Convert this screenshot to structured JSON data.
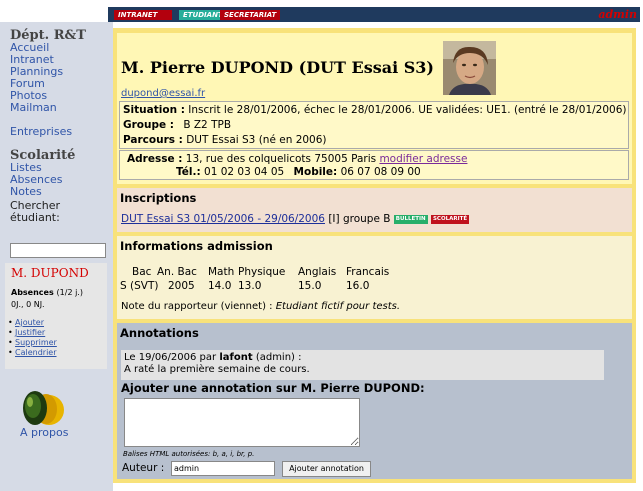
{
  "topbar": {
    "tabs": [
      "INTRANET R&T",
      "ETUDIANT",
      "SECRETARIAT"
    ],
    "admin": "admin"
  },
  "sidebar": {
    "dept_title": "Dépt. R&T",
    "links": [
      "Accueil",
      "Intranet",
      "Plannings",
      "Forum",
      "Photos",
      "Mailman"
    ],
    "entreprises": "Entreprises",
    "scol_title": "Scolarité",
    "scol_links": [
      "Listes",
      "Absences",
      "Notes"
    ],
    "cherche_label_1": "Chercher",
    "cherche_label_2": "étudiant:",
    "student_name": "M. DUPOND",
    "absences_title": "Absences",
    "absences_unit": "(1/2 j.)",
    "absences_count": "0J., 0 NJ.",
    "abs_actions": [
      "Ajouter",
      "Justifier",
      "Supprimer",
      "Calendrier"
    ],
    "apropos": "A propos"
  },
  "fiche": {
    "title": "M. Pierre DUPOND (DUT Essai S3)",
    "email": "dupond@essai.fr",
    "situation_label": "Situation :",
    "situation": "Inscrit le 28/01/2006, échec le 28/01/2006. UE validées: UE1. (entré le 28/01/2006)",
    "groupe_label": "Groupe :",
    "groupe": "B Z2 TPB",
    "parcours_label": "Parcours :",
    "parcours": "DUT Essai S3 (né en 2006)",
    "adresse_label": "Adresse :",
    "adresse": "13, rue des colquelicots 75005 Paris",
    "modifier": "modifier adresse",
    "tel_label": "Tél.:",
    "tel": "01 02 03 04 05",
    "mobile_label": "Mobile:",
    "mobile": "06 07 08 09 00"
  },
  "inscriptions": {
    "title": "Inscriptions",
    "link": "DUT Essai S3 01/05/2006 - 29/06/2006",
    "rest": "[I] groupe B",
    "bulletin": "BULLETIN",
    "scolarite": "SCOLARITÉ"
  },
  "admission": {
    "title": "Informations admission",
    "headers": [
      "Bac",
      "An. Bac",
      "Math",
      "Physique",
      "Anglais",
      "Francais"
    ],
    "values": [
      "S (SVT)",
      "2005",
      "14.0",
      "13.0",
      "15.0",
      "16.0"
    ],
    "note_label": "Note du rapporteur (viennet) :",
    "note": "Etudiant fictif pour tests."
  },
  "annotations": {
    "title": "Annotations",
    "entry_prefix": "Le 19/06/2006 par",
    "entry_author": "lafont",
    "entry_suffix": "(admin) :",
    "entry_text": "A raté la première semaine de cours.",
    "add_title": "Ajouter une annotation sur M. Pierre DUPOND:",
    "balises": "Balises HTML autorisées: b, a, i, br, p.",
    "auteur_label": "Auteur :",
    "auteur_value": "admin",
    "button": "Ajouter annotation"
  }
}
